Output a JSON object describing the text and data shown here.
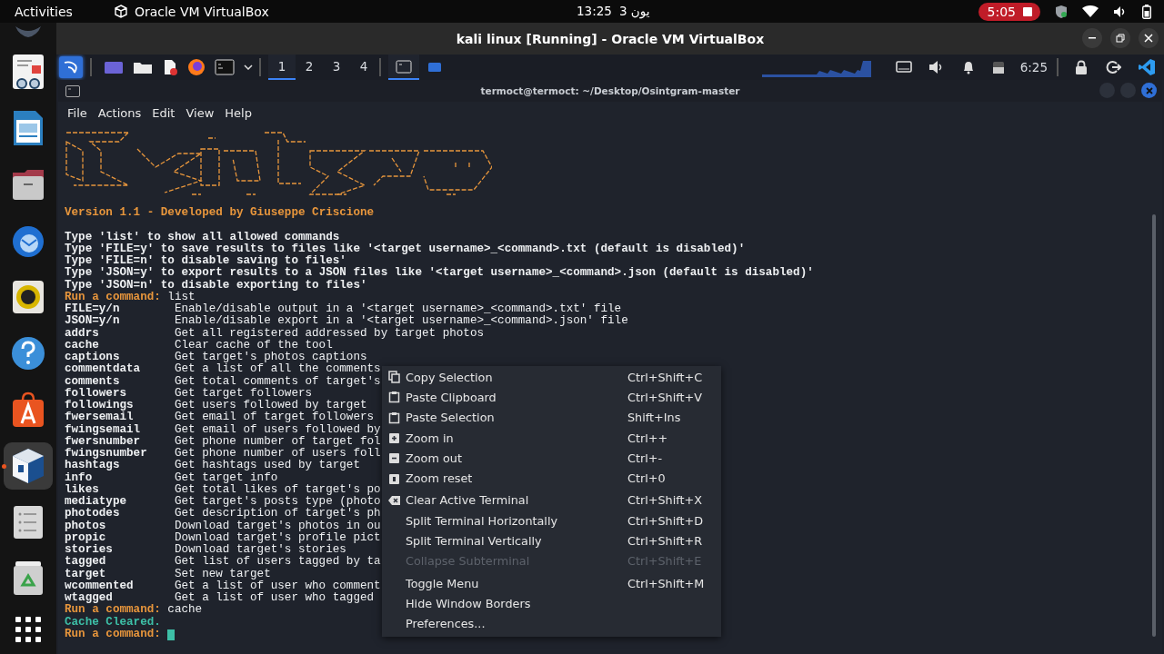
{
  "top_bar": {
    "activities": "Activities",
    "app_name": "Oracle VM VirtualBox",
    "time": "13:25",
    "date": "3 يون",
    "recording_time": "5:05"
  },
  "dock": {
    "items": [
      {
        "running": false
      },
      {
        "running": false
      },
      {
        "running": false
      },
      {
        "running": false
      },
      {
        "running": false
      },
      {
        "running": false
      },
      {
        "running": false
      },
      {
        "running": false
      },
      {
        "running": true
      },
      {
        "running": false
      },
      {
        "running": false
      }
    ]
  },
  "window": {
    "title": "kali linux [Running] - Oracle VM VirtualBox"
  },
  "panel": {
    "workspaces": [
      {
        "label": "1",
        "selected": true
      },
      {
        "label": "2",
        "selected": false
      },
      {
        "label": "3",
        "selected": false
      },
      {
        "label": "4",
        "selected": false
      }
    ],
    "tasks": [
      {
        "selected": true
      },
      {
        "selected": false
      }
    ],
    "clock": "6:25"
  },
  "terminal": {
    "title": "termoct@termoct: ~/Desktop/Osintgram-master",
    "menu": [
      "File",
      "Actions",
      "Edit",
      "View",
      "Help"
    ],
    "lines": [
      {
        "kind": "banner",
        "text": "Version 1.1 - Developed by Giuseppe Criscione"
      },
      {
        "kind": "blank"
      },
      {
        "kind": "text",
        "text": "Type 'list' to show all allowed commands"
      },
      {
        "kind": "text",
        "text": "Type 'FILE=y' to save results to files like '<target username>_<command>.txt (default is disabled)'"
      },
      {
        "kind": "text",
        "text": "Type 'FILE=n' to disable saving to files'"
      },
      {
        "kind": "text",
        "text": "Type 'JSON=y' to export results to a JSON files like '<target username>_<command>.json (default is disabled)'"
      },
      {
        "kind": "text",
        "text": "Type 'JSON=n' to disable exporting to files'"
      },
      {
        "kind": "prompt",
        "prompt": "Run a command:",
        "input": "list",
        "cursor": false
      },
      {
        "kind": "command",
        "command": "FILE=y/n",
        "description": "Enable/disable output in a '<target username>_<command>.txt' file"
      },
      {
        "kind": "command",
        "command": "JSON=y/n",
        "description": "Enable/disable export in a '<target username>_<command>.json' file"
      },
      {
        "kind": "command",
        "command": "addrs",
        "description": "Get all registered addressed by target photos"
      },
      {
        "kind": "command",
        "command": "cache",
        "description": "Clear cache of the tool"
      },
      {
        "kind": "command",
        "command": "captions",
        "description": "Get target's photos captions"
      },
      {
        "kind": "command",
        "command": "commentdata",
        "description": "Get a list of all the comments"
      },
      {
        "kind": "command",
        "command": "comments",
        "description": "Get total comments of target's"
      },
      {
        "kind": "command",
        "command": "followers",
        "description": "Get target followers"
      },
      {
        "kind": "command",
        "command": "followings",
        "description": "Get users followed by target"
      },
      {
        "kind": "command",
        "command": "fwersemail",
        "description": "Get email of target followers"
      },
      {
        "kind": "command",
        "command": "fwingsemail",
        "description": "Get email of users followed by"
      },
      {
        "kind": "command",
        "command": "fwersnumber",
        "description": "Get phone number of target fol"
      },
      {
        "kind": "command",
        "command": "fwingsnumber",
        "description": "Get phone number of users foll"
      },
      {
        "kind": "command",
        "command": "hashtags",
        "description": "Get hashtags used by target"
      },
      {
        "kind": "command",
        "command": "info",
        "description": "Get target info"
      },
      {
        "kind": "command",
        "command": "likes",
        "description": "Get total likes of target's po"
      },
      {
        "kind": "command",
        "command": "mediatype",
        "description": "Get target's posts type (photo"
      },
      {
        "kind": "command",
        "command": "photodes",
        "description": "Get description of target's ph"
      },
      {
        "kind": "command",
        "command": "photos",
        "description": "Download target's photos in ou"
      },
      {
        "kind": "command",
        "command": "propic",
        "description": "Download target's profile pict"
      },
      {
        "kind": "command",
        "command": "stories",
        "description": "Download target's stories"
      },
      {
        "kind": "command",
        "command": "tagged",
        "description": "Get list of users tagged by ta"
      },
      {
        "kind": "command",
        "command": "target",
        "description": "Set new target"
      },
      {
        "kind": "command",
        "command": "wcommented",
        "description": "Get a list of user who comment"
      },
      {
        "kind": "command",
        "command": "wtagged",
        "description": "Get a list of user who tagged"
      },
      {
        "kind": "prompt",
        "prompt": "Run a command:",
        "input": "cache",
        "cursor": false
      },
      {
        "kind": "success",
        "text": "Cache Cleared."
      },
      {
        "kind": "prompt",
        "prompt": "Run a command:",
        "cursor": true
      }
    ]
  },
  "context_menu": {
    "items": [
      {
        "kind": "action",
        "label": "Copy Selection",
        "shortcut": "Ctrl+Shift+C",
        "disabled": false
      },
      {
        "kind": "action",
        "label": "Paste Clipboard",
        "shortcut": "Ctrl+Shift+V",
        "disabled": false
      },
      {
        "kind": "action",
        "label": "Paste Selection",
        "shortcut": "Shift+Ins",
        "disabled": false
      },
      {
        "kind": "action",
        "label": "Zoom in",
        "shortcut": "Ctrl++",
        "disabled": false
      },
      {
        "kind": "action",
        "label": "Zoom out",
        "shortcut": "Ctrl+-",
        "disabled": false
      },
      {
        "kind": "action",
        "label": "Zoom reset",
        "shortcut": "Ctrl+0",
        "disabled": false
      },
      {
        "kind": "separator"
      },
      {
        "kind": "action",
        "label": "Clear Active Terminal",
        "shortcut": "Ctrl+Shift+X",
        "disabled": false
      },
      {
        "kind": "action",
        "label": "Split Terminal Horizontally",
        "shortcut": "Ctrl+Shift+D",
        "disabled": false
      },
      {
        "kind": "action",
        "label": "Split Terminal Vertically",
        "shortcut": "Ctrl+Shift+R",
        "disabled": false
      },
      {
        "kind": "action",
        "label": "Collapse Subterminal",
        "shortcut": "Ctrl+Shift+E",
        "disabled": true
      },
      {
        "kind": "separator"
      },
      {
        "kind": "action",
        "label": "Toggle Menu",
        "shortcut": "Ctrl+Shift+M",
        "disabled": false
      },
      {
        "kind": "action",
        "label": "Hide Window Borders",
        "disabled": false
      },
      {
        "kind": "action",
        "label": "Preferences...",
        "disabled": false
      }
    ]
  }
}
